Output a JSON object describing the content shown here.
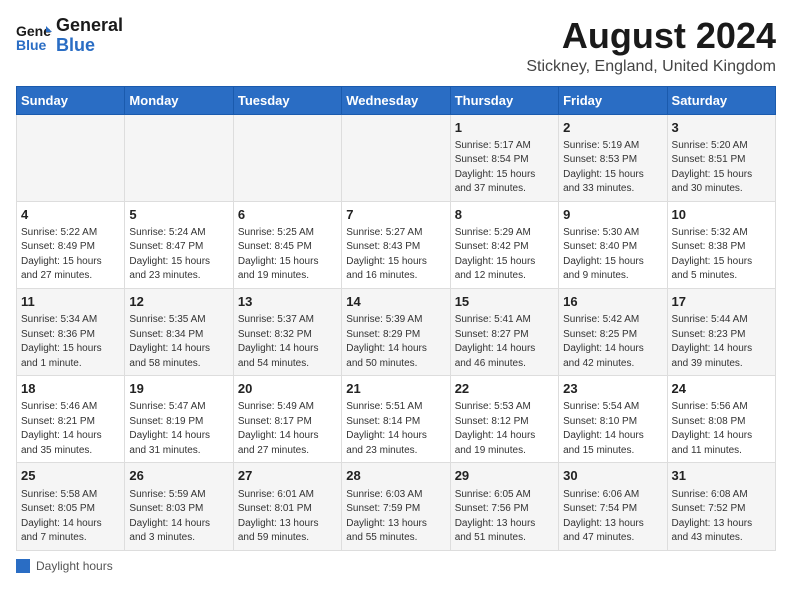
{
  "header": {
    "logo_line1": "General",
    "logo_line2": "Blue",
    "title": "August 2024",
    "subtitle": "Stickney, England, United Kingdom"
  },
  "legend": {
    "label": "Daylight hours"
  },
  "columns": [
    "Sunday",
    "Monday",
    "Tuesday",
    "Wednesday",
    "Thursday",
    "Friday",
    "Saturday"
  ],
  "weeks": [
    {
      "cells": [
        {
          "day": "",
          "info": ""
        },
        {
          "day": "",
          "info": ""
        },
        {
          "day": "",
          "info": ""
        },
        {
          "day": "",
          "info": ""
        },
        {
          "day": "1",
          "info": "Sunrise: 5:17 AM\nSunset: 8:54 PM\nDaylight: 15 hours\nand 37 minutes."
        },
        {
          "day": "2",
          "info": "Sunrise: 5:19 AM\nSunset: 8:53 PM\nDaylight: 15 hours\nand 33 minutes."
        },
        {
          "day": "3",
          "info": "Sunrise: 5:20 AM\nSunset: 8:51 PM\nDaylight: 15 hours\nand 30 minutes."
        }
      ]
    },
    {
      "cells": [
        {
          "day": "4",
          "info": "Sunrise: 5:22 AM\nSunset: 8:49 PM\nDaylight: 15 hours\nand 27 minutes."
        },
        {
          "day": "5",
          "info": "Sunrise: 5:24 AM\nSunset: 8:47 PM\nDaylight: 15 hours\nand 23 minutes."
        },
        {
          "day": "6",
          "info": "Sunrise: 5:25 AM\nSunset: 8:45 PM\nDaylight: 15 hours\nand 19 minutes."
        },
        {
          "day": "7",
          "info": "Sunrise: 5:27 AM\nSunset: 8:43 PM\nDaylight: 15 hours\nand 16 minutes."
        },
        {
          "day": "8",
          "info": "Sunrise: 5:29 AM\nSunset: 8:42 PM\nDaylight: 15 hours\nand 12 minutes."
        },
        {
          "day": "9",
          "info": "Sunrise: 5:30 AM\nSunset: 8:40 PM\nDaylight: 15 hours\nand 9 minutes."
        },
        {
          "day": "10",
          "info": "Sunrise: 5:32 AM\nSunset: 8:38 PM\nDaylight: 15 hours\nand 5 minutes."
        }
      ]
    },
    {
      "cells": [
        {
          "day": "11",
          "info": "Sunrise: 5:34 AM\nSunset: 8:36 PM\nDaylight: 15 hours\nand 1 minute."
        },
        {
          "day": "12",
          "info": "Sunrise: 5:35 AM\nSunset: 8:34 PM\nDaylight: 14 hours\nand 58 minutes."
        },
        {
          "day": "13",
          "info": "Sunrise: 5:37 AM\nSunset: 8:32 PM\nDaylight: 14 hours\nand 54 minutes."
        },
        {
          "day": "14",
          "info": "Sunrise: 5:39 AM\nSunset: 8:29 PM\nDaylight: 14 hours\nand 50 minutes."
        },
        {
          "day": "15",
          "info": "Sunrise: 5:41 AM\nSunset: 8:27 PM\nDaylight: 14 hours\nand 46 minutes."
        },
        {
          "day": "16",
          "info": "Sunrise: 5:42 AM\nSunset: 8:25 PM\nDaylight: 14 hours\nand 42 minutes."
        },
        {
          "day": "17",
          "info": "Sunrise: 5:44 AM\nSunset: 8:23 PM\nDaylight: 14 hours\nand 39 minutes."
        }
      ]
    },
    {
      "cells": [
        {
          "day": "18",
          "info": "Sunrise: 5:46 AM\nSunset: 8:21 PM\nDaylight: 14 hours\nand 35 minutes."
        },
        {
          "day": "19",
          "info": "Sunrise: 5:47 AM\nSunset: 8:19 PM\nDaylight: 14 hours\nand 31 minutes."
        },
        {
          "day": "20",
          "info": "Sunrise: 5:49 AM\nSunset: 8:17 PM\nDaylight: 14 hours\nand 27 minutes."
        },
        {
          "day": "21",
          "info": "Sunrise: 5:51 AM\nSunset: 8:14 PM\nDaylight: 14 hours\nand 23 minutes."
        },
        {
          "day": "22",
          "info": "Sunrise: 5:53 AM\nSunset: 8:12 PM\nDaylight: 14 hours\nand 19 minutes."
        },
        {
          "day": "23",
          "info": "Sunrise: 5:54 AM\nSunset: 8:10 PM\nDaylight: 14 hours\nand 15 minutes."
        },
        {
          "day": "24",
          "info": "Sunrise: 5:56 AM\nSunset: 8:08 PM\nDaylight: 14 hours\nand 11 minutes."
        }
      ]
    },
    {
      "cells": [
        {
          "day": "25",
          "info": "Sunrise: 5:58 AM\nSunset: 8:05 PM\nDaylight: 14 hours\nand 7 minutes."
        },
        {
          "day": "26",
          "info": "Sunrise: 5:59 AM\nSunset: 8:03 PM\nDaylight: 14 hours\nand 3 minutes."
        },
        {
          "day": "27",
          "info": "Sunrise: 6:01 AM\nSunset: 8:01 PM\nDaylight: 13 hours\nand 59 minutes."
        },
        {
          "day": "28",
          "info": "Sunrise: 6:03 AM\nSunset: 7:59 PM\nDaylight: 13 hours\nand 55 minutes."
        },
        {
          "day": "29",
          "info": "Sunrise: 6:05 AM\nSunset: 7:56 PM\nDaylight: 13 hours\nand 51 minutes."
        },
        {
          "day": "30",
          "info": "Sunrise: 6:06 AM\nSunset: 7:54 PM\nDaylight: 13 hours\nand 47 minutes."
        },
        {
          "day": "31",
          "info": "Sunrise: 6:08 AM\nSunset: 7:52 PM\nDaylight: 13 hours\nand 43 minutes."
        }
      ]
    }
  ]
}
